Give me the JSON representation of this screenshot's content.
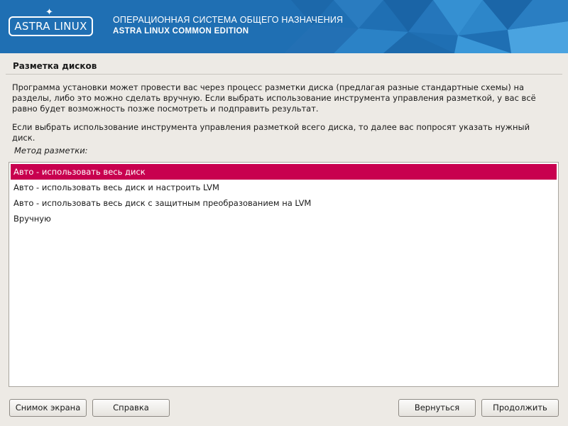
{
  "header": {
    "logo_text": "ASTRA LINUX",
    "logo_mark": "✦",
    "line1": "ОПЕРАЦИОННАЯ СИСТЕМА ОБЩЕГО НАЗНАЧЕНИЯ",
    "line2": "ASTRA LINUX COMMON EDITION",
    "colors": {
      "background": "#1f6fb3",
      "text": "#ffffff"
    }
  },
  "page": {
    "title": "Разметка дисков",
    "paragraph1": "Программа установки может провести вас через процесс разметки диска (предлагая разные стандартные схемы) на разделы, либо это можно сделать вручную. Если выбрать использование инструмента управления разметкой, у вас всё равно будет возможность позже посмотреть и подправить результат.",
    "paragraph2": "Если выбрать использование инструмента управления разметкой всего диска, то далее вас попросят указать нужный диск.",
    "method_label": "Метод разметки:"
  },
  "methods": {
    "selected_index": 0,
    "items": [
      "Авто - использовать весь диск",
      "Авто - использовать весь диск и настроить LVM",
      "Авто - использовать весь диск с защитным преобразованием на LVM",
      "Вручную"
    ]
  },
  "buttons": {
    "screenshot": "Снимок экрана",
    "help": "Справка",
    "back": "Вернуться",
    "continue": "Продолжить"
  },
  "colors": {
    "accent": "#c8004f",
    "background": "#edeae5"
  }
}
